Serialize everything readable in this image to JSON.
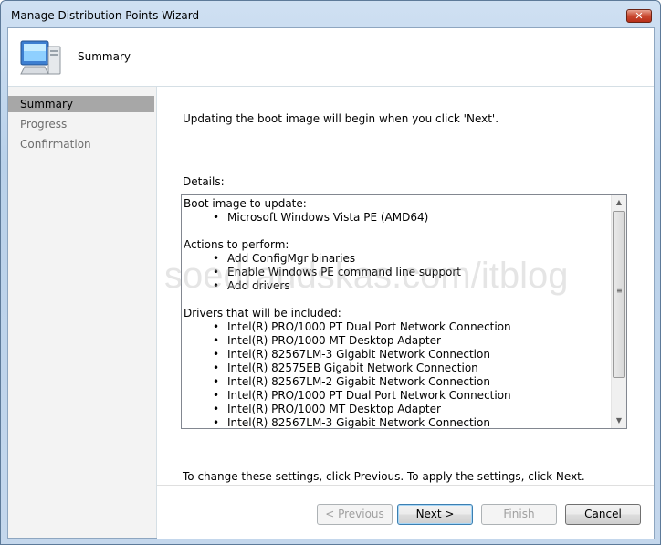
{
  "window": {
    "title": "Manage Distribution Points Wizard",
    "close_glyph": "✕"
  },
  "header": {
    "title": "Summary"
  },
  "nav": {
    "items": [
      {
        "label": "Summary",
        "active": true
      },
      {
        "label": "Progress",
        "active": false
      },
      {
        "label": "Confirmation",
        "active": false
      }
    ]
  },
  "main": {
    "intro": "Updating the boot image will begin when you click 'Next'.",
    "details_label": "Details:",
    "details": {
      "boot_image_heading": "Boot image to update:",
      "boot_images": [
        "Microsoft Windows Vista PE (AMD64)"
      ],
      "actions_heading": "Actions to perform:",
      "actions": [
        "Add ConfigMgr binaries",
        "Enable Windows PE command line support",
        "Add drivers"
      ],
      "drivers_heading": "Drivers that will be included:",
      "drivers": [
        "Intel(R) PRO/1000 PT Dual Port Network Connection",
        "Intel(R) PRO/1000 MT Desktop Adapter",
        "Intel(R) 82567LM-3 Gigabit Network Connection",
        "Intel(R) 82575EB Gigabit Network Connection",
        "Intel(R) 82567LM-2 Gigabit Network Connection",
        "Intel(R) PRO/1000 PT Dual Port Network Connection",
        "Intel(R) PRO/1000 MT Desktop Adapter",
        "Intel(R) 82567LM-3 Gigabit Network Connection"
      ]
    },
    "footer_text": "To change these settings, click Previous. To apply the settings, click Next."
  },
  "buttons": {
    "previous": "< Previous",
    "next": "Next >",
    "finish": "Finish",
    "cancel": "Cancel"
  },
  "watermark": "soedraudskas.com/itblog",
  "colors": {
    "nav_active": "#a7a7a7",
    "title_bar": "#b9d1ea",
    "close_button": "#c9482f"
  }
}
